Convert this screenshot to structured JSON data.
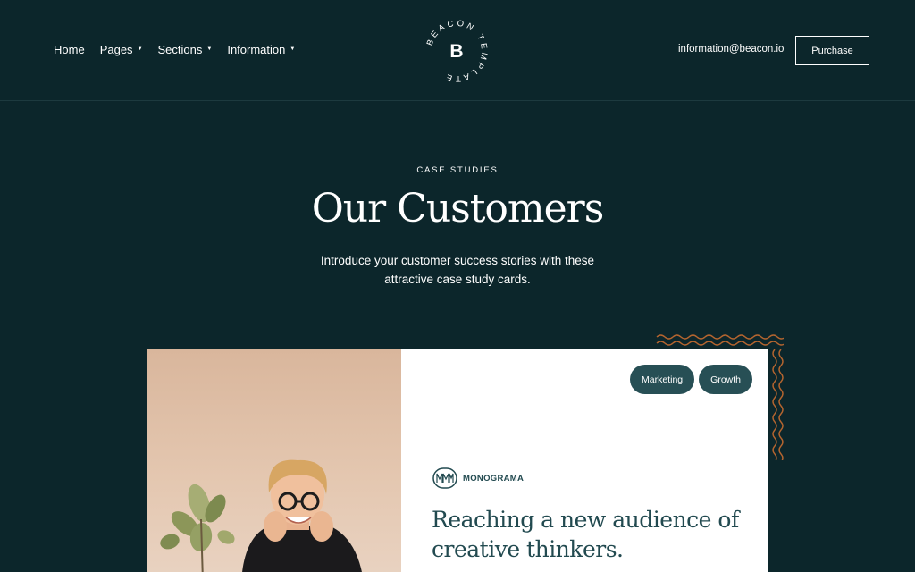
{
  "nav": {
    "items": [
      {
        "label": "Home",
        "has_dropdown": false
      },
      {
        "label": "Pages",
        "has_dropdown": true
      },
      {
        "label": "Sections",
        "has_dropdown": true
      },
      {
        "label": "Information",
        "has_dropdown": true
      }
    ],
    "logo": {
      "letter": "B",
      "ring_text": "BEACON TEMPLATE"
    },
    "email": "information@beacon.io",
    "purchase_label": "Purchase"
  },
  "hero": {
    "eyebrow": "CASE STUDIES",
    "title": "Our Customers",
    "subtitle": "Introduce your customer success stories with these attractive case study cards."
  },
  "card": {
    "tags": [
      "Marketing",
      "Growth"
    ],
    "brand": {
      "icon": "monograma-logo-icon",
      "name": "MONOGRAMA"
    },
    "heading": "Reaching a new audience of creative thinkers."
  },
  "colors": {
    "background": "#0c262b",
    "accent_teal": "#274f55",
    "heading_teal": "#224a50",
    "wave_orange": "#b5652f",
    "card_bg": "#ffffff"
  }
}
